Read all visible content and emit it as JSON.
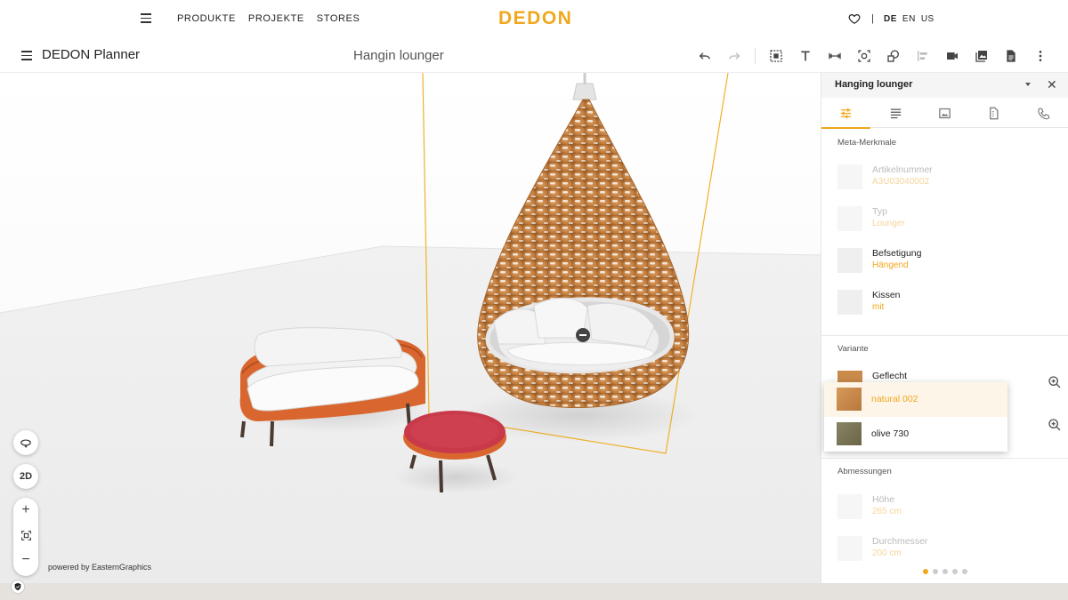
{
  "site_nav": {
    "links": [
      "PRODUKTE",
      "PROJEKTE",
      "STORES"
    ],
    "brand": "DEDON",
    "separator": "|",
    "languages": [
      "DE",
      "EN",
      "US"
    ],
    "active_language": "DE"
  },
  "toolbar": {
    "app_name": "DEDON Planner",
    "document_title": "Hangin lounger",
    "tools": [
      "undo-icon",
      "redo-icon",
      "select-area-icon",
      "text-icon",
      "measure-icon",
      "snapshot-icon",
      "shapes-icon",
      "align-icon",
      "video-icon",
      "gallery-icon",
      "document-icon",
      "more-icon"
    ]
  },
  "viewport": {
    "powered_by": "powered by EasternGraphics",
    "view_mode_label": "2D",
    "zoom_in": "+",
    "zoom_out": "−"
  },
  "panel": {
    "title": "Hanging lounger",
    "tabs": [
      "sliders-icon",
      "list-icon",
      "image-icon",
      "file-icon",
      "phone-icon"
    ],
    "sections": {
      "meta": "Meta-Merkmale",
      "variant": "Variante",
      "dimensions": "Abmessungen"
    },
    "meta_properties": [
      {
        "name": "Artikelnummer",
        "value": "A3U03040002"
      },
      {
        "name": "Typ",
        "value": "Lounger"
      },
      {
        "name": "Befsetigung",
        "value": "Hängend"
      },
      {
        "name": "Kissen",
        "value": "mit"
      }
    ],
    "variant_property": {
      "name": "Geflecht"
    },
    "dimension_properties": [
      {
        "name": "Höhe",
        "value": "265 cm"
      },
      {
        "name": "Durchmesser",
        "value": "200 cm"
      }
    ],
    "page_dots": 5,
    "active_dot": 1
  },
  "dropdown": {
    "options": [
      {
        "label": "natural 002",
        "selected": true,
        "color": "#c98a4a"
      },
      {
        "label": "olive 730",
        "selected": false,
        "color": "#7a7558"
      }
    ]
  },
  "colors": {
    "accent": "#f0a71c",
    "wicker": "#c88a4e",
    "sofa_frame": "#d9662e",
    "table_top": "#c8394a"
  }
}
